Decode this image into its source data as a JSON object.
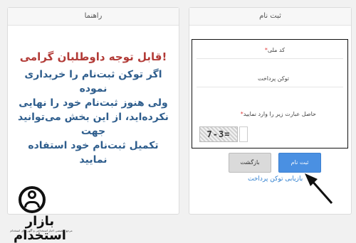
{
  "guide": {
    "header": "راهنما",
    "title": "قابل توجه داوطلبان گرامی!",
    "lines": [
      "اگر توکن ثبت‌نام را خریداری نموده",
      "ولی هنوز ثبت‌نام خود را نهایی",
      "نکرده‌اید، از این بخش می‌توانید جهت",
      "تکمیل ثبت‌نام خود استفاده نمایید"
    ]
  },
  "register": {
    "header": "ثبت نام",
    "fields": {
      "national_code_label": "کد ملی",
      "payment_token_label": "توکن پرداخت",
      "captcha_label": "حاصل عبارت زیر را وارد نمایید"
    },
    "captcha_text": "7-3=",
    "buttons": {
      "back": "بازگشت",
      "register": "ثبت نام"
    },
    "retrieve_link": "بازیابی توکن پرداخت"
  },
  "logo": {
    "text": "بازار استخدام",
    "subtitle": "مرجع تخصصی اخبار استخدامی و آگهی های استخدام"
  }
}
